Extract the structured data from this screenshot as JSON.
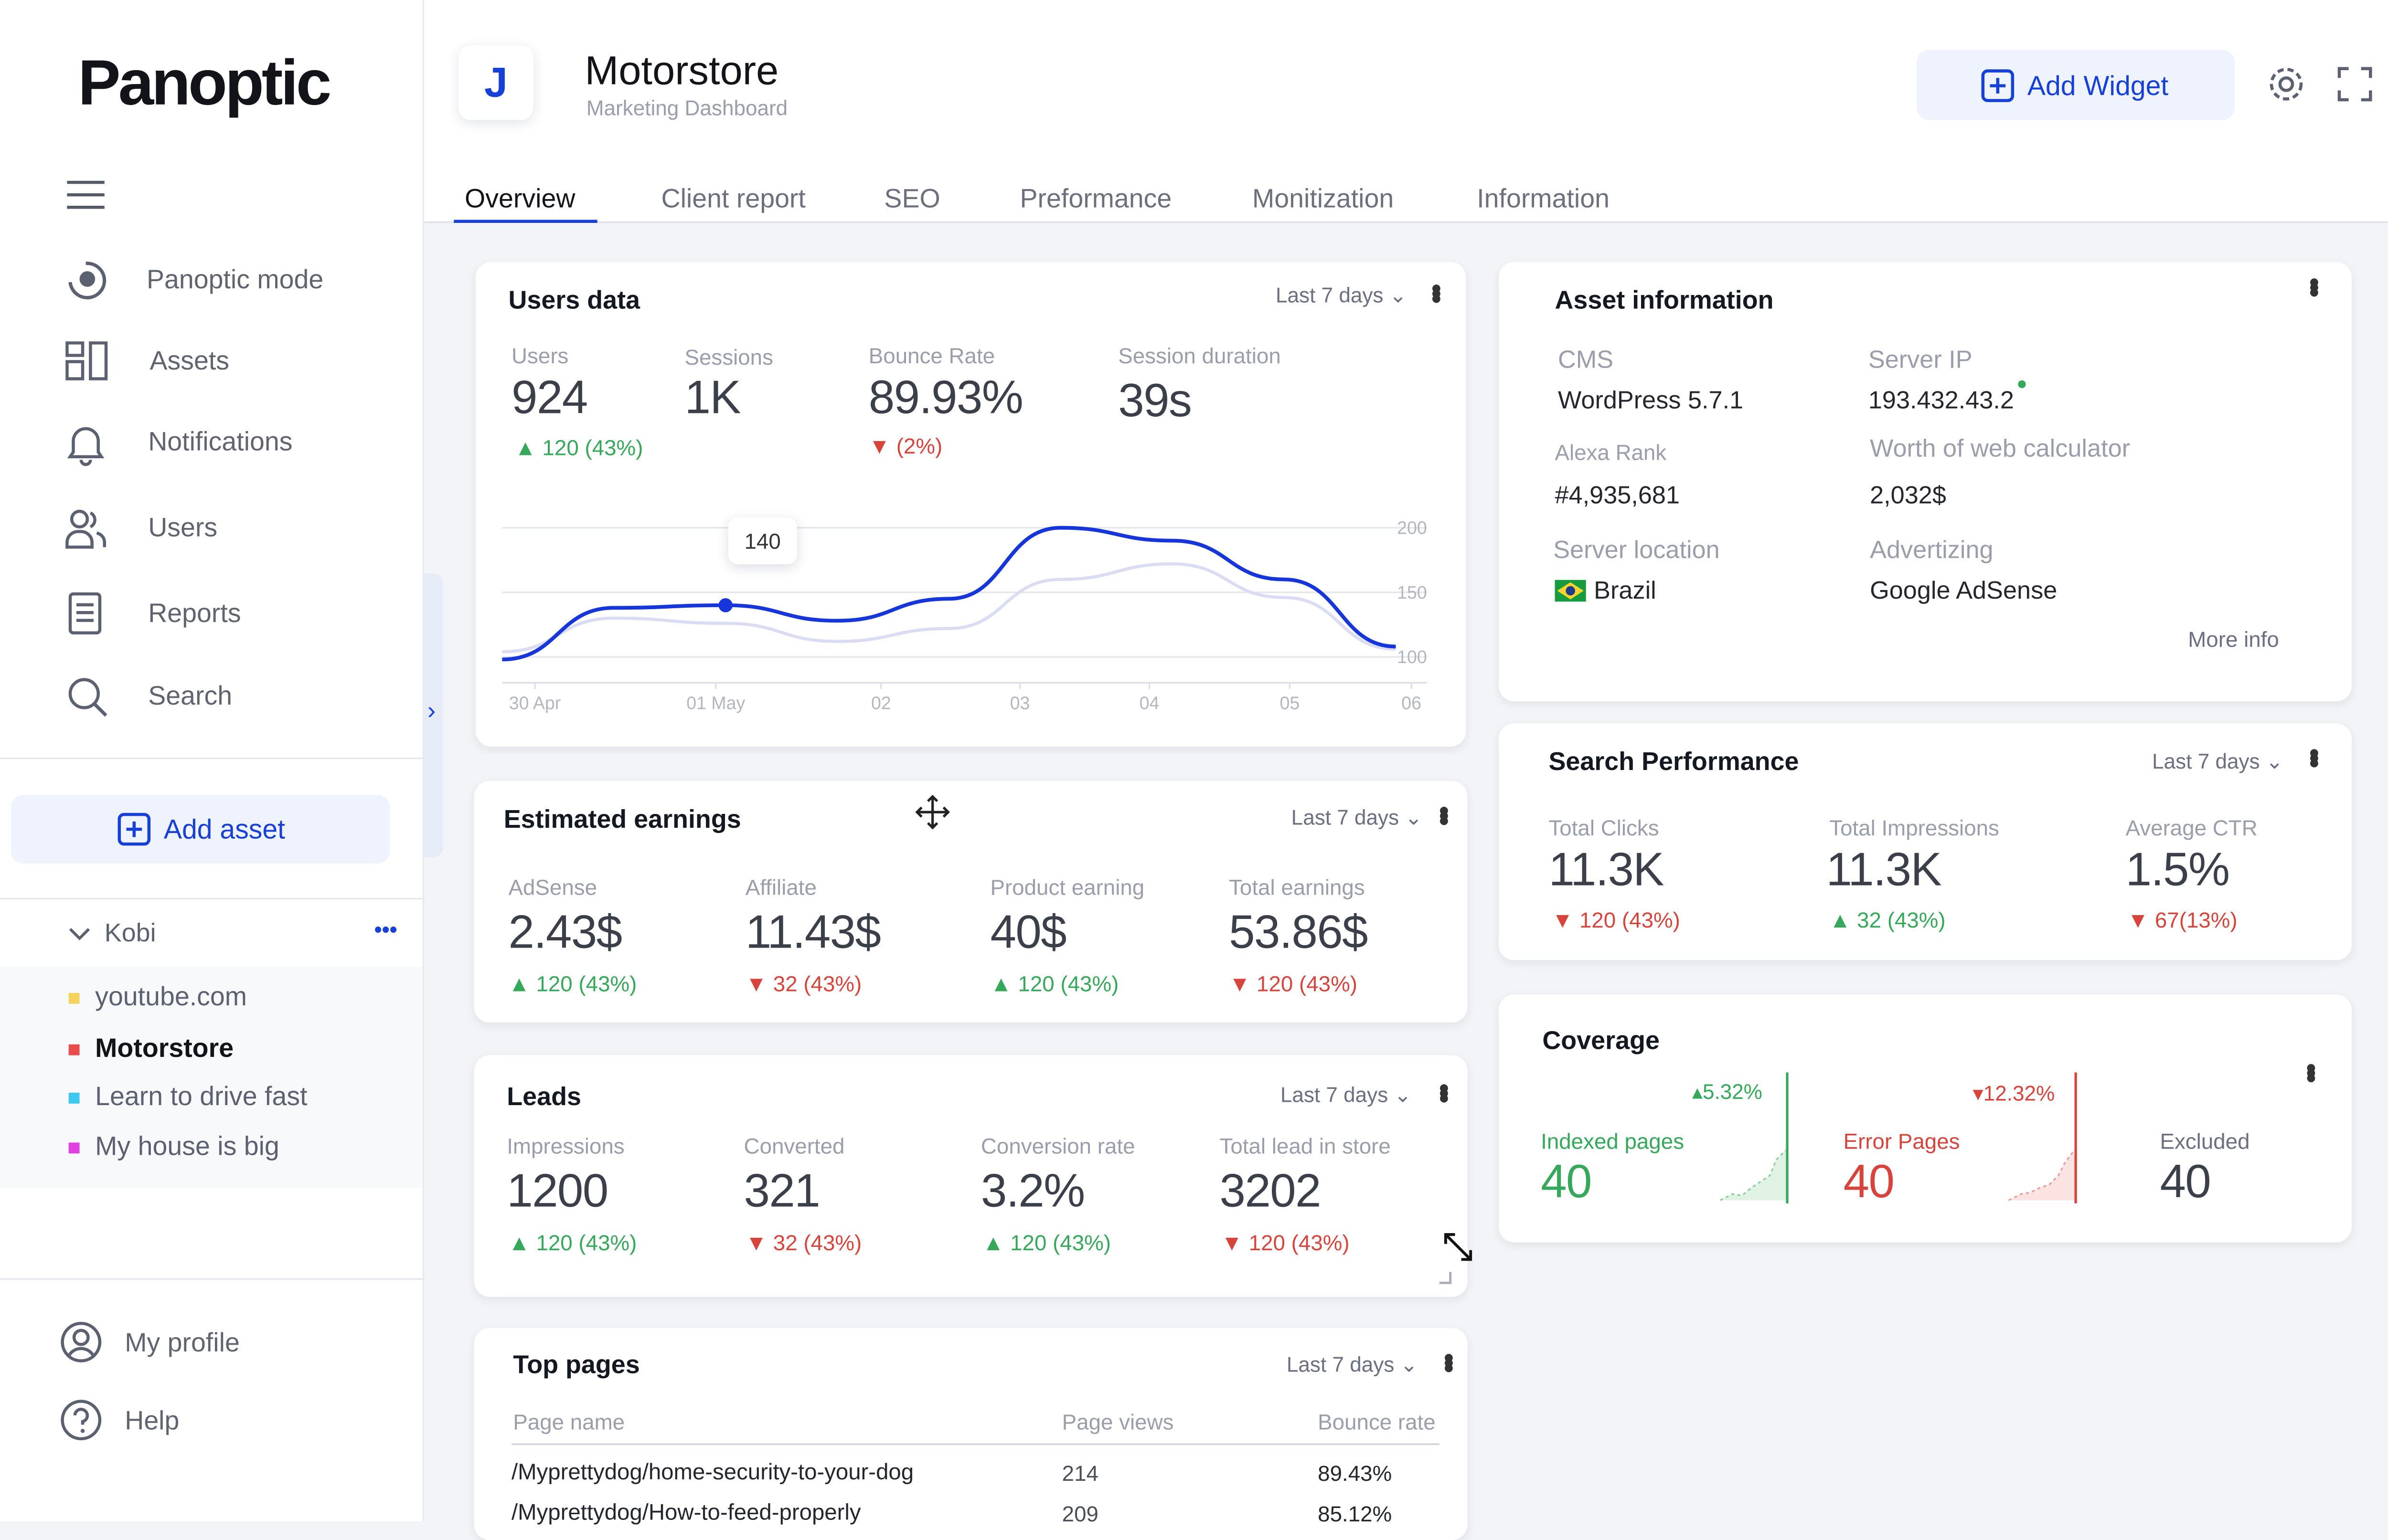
{
  "brand": {
    "logo_text": "Panoptic",
    "colors": {
      "accent": "#1640D6",
      "up": "#36A85A",
      "down": "#D6443C"
    }
  },
  "sidebar": {
    "nav": [
      {
        "label": "Panoptic mode",
        "icon": "panoptic-mode-icon"
      },
      {
        "label": "Assets",
        "icon": "assets-icon"
      },
      {
        "label": "Notifications",
        "icon": "bell-icon"
      },
      {
        "label": "Users",
        "icon": "users-icon"
      },
      {
        "label": "Reports",
        "icon": "reports-icon"
      },
      {
        "label": "Search",
        "icon": "search-icon"
      }
    ],
    "add_asset": "Add asset",
    "group": {
      "name": "Kobi",
      "more": "•••"
    },
    "assets": [
      {
        "label": "youtube.com",
        "color": "#F4D35E"
      },
      {
        "label": "Motorstore",
        "color": "#E84C4C",
        "active": true
      },
      {
        "label": "Learn to drive fast",
        "color": "#3EC8F0"
      },
      {
        "label": "My house is big",
        "color": "#E040E0"
      }
    ],
    "footer": [
      {
        "label": "My profile",
        "icon": "profile-icon"
      },
      {
        "label": "Help",
        "icon": "help-icon"
      }
    ],
    "collapse_arrow": "›"
  },
  "header": {
    "avatar_letter": "J",
    "title": "Motorstore",
    "subtitle": "Marketing Dashboard",
    "add_widget": "Add Widget",
    "tabs": [
      "Overview",
      "Client report",
      "SEO",
      "Preformance",
      "Monitization",
      "Information"
    ],
    "active_tab": "Overview"
  },
  "users_data": {
    "title": "Users data",
    "range": "Last 7 days",
    "metrics": [
      {
        "label": "Users",
        "value": "924",
        "change": "120 (43%)",
        "dir": "up"
      },
      {
        "label": "Sessions",
        "value": "1K",
        "change": "",
        "dir": ""
      },
      {
        "label": "Bounce Rate",
        "value": "89.93%",
        "change": "(2%)",
        "dir": "down"
      },
      {
        "label": "Session duration",
        "value": "39s",
        "change": "",
        "dir": ""
      }
    ]
  },
  "chart_data": {
    "type": "line",
    "x": [
      "30 Apr",
      "01 May",
      "02",
      "03",
      "04",
      "05",
      "06"
    ],
    "y_ticks": [
      100,
      150,
      200
    ],
    "ylim": [
      80,
      220
    ],
    "series": [
      {
        "values": [
          98,
          138,
          140,
          128,
          145,
          200,
          190,
          160,
          108
        ]
      },
      {
        "values": [
          104,
          130,
          126,
          112,
          122,
          160,
          172,
          146,
          106
        ]
      }
    ],
    "tooltip": {
      "label": "140"
    }
  },
  "earnings": {
    "title": "Estimated earnings",
    "range": "Last 7 days",
    "metrics": [
      {
        "label": "AdSense",
        "value": "2.43$",
        "change": "120 (43%)",
        "dir": "up"
      },
      {
        "label": "Affiliate",
        "value": "11.43$",
        "change": "32 (43%)",
        "dir": "down"
      },
      {
        "label": "Product earning",
        "value": "40$",
        "change": "120 (43%)",
        "dir": "up"
      },
      {
        "label": "Total earnings",
        "value": "53.86$",
        "change": "120 (43%)",
        "dir": "down"
      }
    ]
  },
  "leads": {
    "title": "Leads",
    "range": "Last 7 days",
    "metrics": [
      {
        "label": "Impressions",
        "value": "1200",
        "change": "120 (43%)",
        "dir": "up"
      },
      {
        "label": "Converted",
        "value": "321",
        "change": "32 (43%)",
        "dir": "down"
      },
      {
        "label": "Conversion rate",
        "value": "3.2%",
        "change": "120 (43%)",
        "dir": "up"
      },
      {
        "label": "Total lead in store",
        "value": "3202",
        "change": "120 (43%)",
        "dir": "down"
      }
    ]
  },
  "top_pages": {
    "title": "Top pages",
    "range": "Last 7 days",
    "columns": [
      "Page name",
      "Page views",
      "Bounce rate"
    ],
    "rows": [
      [
        "/Myprettydog/home-security-to-your-dog",
        "214",
        "89.43%"
      ],
      [
        "/Myprettydog/How-to-feed-properly",
        "209",
        "85.12%"
      ]
    ]
  },
  "asset_info": {
    "title": "Asset information",
    "fields": [
      {
        "label": "CMS",
        "value": "WordPress 5.7.1"
      },
      {
        "label": "Server IP",
        "value": "193.432.43.2"
      },
      {
        "label": "Alexa Rank",
        "value": "#4,935,681"
      },
      {
        "label": "Worth of web calculator",
        "value": "2,032$"
      },
      {
        "label": "Server location",
        "value": "Brazil"
      },
      {
        "label": "Advertizing",
        "value": "Google AdSense"
      }
    ],
    "more": "More info"
  },
  "search_performance": {
    "title": "Search Performance",
    "range": "Last 7 days",
    "metrics": [
      {
        "label": "Total Clicks",
        "value": "11.3K",
        "change": "120 (43%)",
        "dir": "down"
      },
      {
        "label": "Total Impressions",
        "value": "11.3K",
        "change": "32  (43%)",
        "dir": "up"
      },
      {
        "label": "Average CTR",
        "value": "1.5%",
        "change": "67(13%)",
        "dir": "down"
      }
    ]
  },
  "coverage": {
    "title": "Coverage",
    "items": [
      {
        "label": "Indexed pages",
        "value": "40",
        "change": "5.32%",
        "dir": "up"
      },
      {
        "label": "Error Pages",
        "value": "40",
        "change": "12.32%",
        "dir": "down"
      },
      {
        "label": "Excluded",
        "value": "40",
        "change": "",
        "dir": ""
      }
    ]
  }
}
